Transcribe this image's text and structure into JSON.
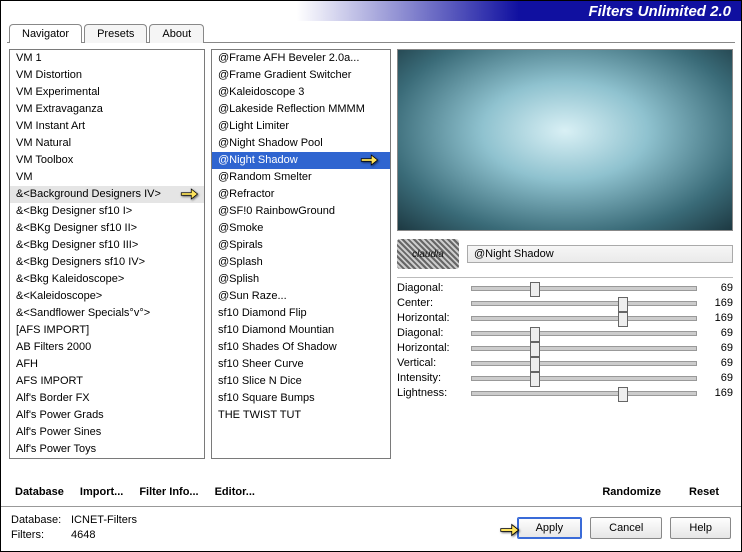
{
  "title": "Filters Unlimited 2.0",
  "tabs": [
    "Navigator",
    "Presets",
    "About"
  ],
  "active_tab": 0,
  "categories": [
    "VM 1",
    "VM Distortion",
    "VM Experimental",
    "VM Extravaganza",
    "VM Instant Art",
    "VM Natural",
    "VM Toolbox",
    "VM",
    "&<Background Designers IV>",
    "&<Bkg Designer sf10 I>",
    "&<BKg Designer sf10 II>",
    "&<Bkg Designer sf10 III>",
    "&<Bkg Designers sf10 IV>",
    "&<Bkg Kaleidoscope>",
    "&<Kaleidoscope>",
    "&<Sandflower Specials°v°>",
    "[AFS IMPORT]",
    "AB Filters 2000",
    "AFH",
    "AFS IMPORT",
    "Alf's Border FX",
    "Alf's Power Grads",
    "Alf's Power Sines",
    "Alf's Power Toys"
  ],
  "category_selected": 8,
  "filters": [
    "@Frame AFH Beveler 2.0a...",
    "@Frame Gradient Switcher",
    "@Kaleidoscope 3",
    "@Lakeside Reflection MMMM",
    "@Light Limiter",
    "@Night Shadow Pool",
    "@Night Shadow",
    "@Random Smelter",
    "@Refractor",
    "@SF!0 RainbowGround",
    "@Smoke",
    "@Spirals",
    "@Splash",
    "@Splish",
    "@Sun Raze...",
    "sf10 Diamond Flip",
    "sf10 Diamond Mountian",
    "sf10 Shades Of Shadow",
    "sf10 Sheer Curve",
    "sf10 Slice N Dice",
    "sf10 Square Bumps",
    "THE TWIST TUT"
  ],
  "filter_selected": 6,
  "selected_filter_name": "@Night Shadow",
  "stamp_label": "claudia",
  "params": [
    {
      "label": "Diagonal:",
      "value": 69,
      "pos": 26
    },
    {
      "label": "Center:",
      "value": 169,
      "pos": 65
    },
    {
      "label": "Horizontal:",
      "value": 169,
      "pos": 65
    },
    {
      "label": "Diagonal:",
      "value": 69,
      "pos": 26
    },
    {
      "label": "Horizontal:",
      "value": 69,
      "pos": 26
    },
    {
      "label": "Vertical:",
      "value": 69,
      "pos": 26
    },
    {
      "label": "Intensity:",
      "value": 69,
      "pos": 26
    },
    {
      "label": "Lightness:",
      "value": 169,
      "pos": 65
    }
  ],
  "buttons": {
    "database": "Database",
    "import": "Import...",
    "filter_info": "Filter Info...",
    "editor": "Editor...",
    "randomize": "Randomize",
    "reset": "Reset"
  },
  "footer": {
    "db_label": "Database:",
    "db_value": "ICNET-Filters",
    "filters_label": "Filters:",
    "filters_value": "4648"
  },
  "footer_buttons": {
    "apply": "Apply",
    "cancel": "Cancel",
    "help": "Help"
  }
}
